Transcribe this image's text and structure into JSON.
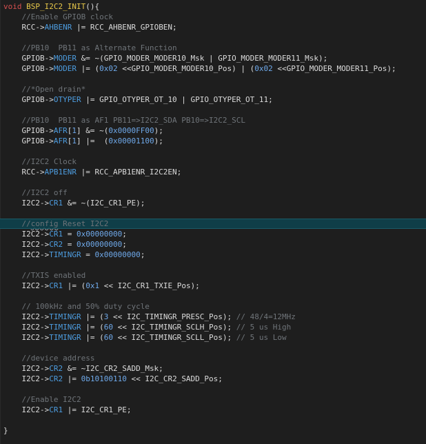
{
  "editor": {
    "current_line_index": 21,
    "lines": [
      [
        [
          "kw",
          "void"
        ],
        [
          "plain",
          " "
        ],
        [
          "fn",
          "BSP_I2C2_INIT"
        ],
        [
          "plain",
          "(){"
        ]
      ],
      [
        [
          "plain",
          "    "
        ],
        [
          "comment",
          "//Enable GPIOB clock"
        ]
      ],
      [
        [
          "plain",
          "    RCC->"
        ],
        [
          "member",
          "AHBENR"
        ],
        [
          "plain",
          " |= RCC_AHBENR_GPIOBEN;"
        ]
      ],
      [],
      [
        [
          "plain",
          "    "
        ],
        [
          "comment",
          "//PB10  PB11 as Alternate Function"
        ]
      ],
      [
        [
          "plain",
          "    GPIOB->"
        ],
        [
          "member",
          "MODER"
        ],
        [
          "plain",
          " &= ~(GPIO_MODER_MODER10_Msk | GPIO_MODER_MODER11_Msk);"
        ]
      ],
      [
        [
          "plain",
          "    GPIOB->"
        ],
        [
          "member",
          "MODER"
        ],
        [
          "plain",
          " |= ("
        ],
        [
          "num",
          "0x02"
        ],
        [
          "plain",
          " <<GPIO_MODER_MODER10_Pos) | ("
        ],
        [
          "num",
          "0x02"
        ],
        [
          "plain",
          " <<GPIO_MODER_MODER11_Pos);"
        ]
      ],
      [],
      [
        [
          "plain",
          "    "
        ],
        [
          "comment",
          "//*Open drain*"
        ]
      ],
      [
        [
          "plain",
          "    GPIOB->"
        ],
        [
          "member",
          "OTYPER"
        ],
        [
          "plain",
          " |= GPIO_OTYPER_OT_10 | GPIO_OTYPER_OT_11;"
        ]
      ],
      [],
      [
        [
          "plain",
          "    "
        ],
        [
          "comment",
          "//PB10  PB11 as AF1 PB11=>I2C2_SDA PB10=>I2C2_SCL"
        ]
      ],
      [
        [
          "plain",
          "    GPIOB->"
        ],
        [
          "member",
          "AFR"
        ],
        [
          "plain",
          "["
        ],
        [
          "num",
          "1"
        ],
        [
          "plain",
          "] &= ~("
        ],
        [
          "num",
          "0x0000FF00"
        ],
        [
          "plain",
          ");"
        ]
      ],
      [
        [
          "plain",
          "    GPIOB->"
        ],
        [
          "member",
          "AFR"
        ],
        [
          "plain",
          "["
        ],
        [
          "num",
          "1"
        ],
        [
          "plain",
          "] |=  ("
        ],
        [
          "num",
          "0x00001100"
        ],
        [
          "plain",
          ");"
        ]
      ],
      [],
      [
        [
          "plain",
          "    "
        ],
        [
          "comment",
          "//I2C2 Clock"
        ]
      ],
      [
        [
          "plain",
          "    RCC->"
        ],
        [
          "member",
          "APB1ENR"
        ],
        [
          "plain",
          " |= RCC_APB1ENR_I2C2EN;"
        ]
      ],
      [],
      [
        [
          "plain",
          "    "
        ],
        [
          "comment",
          "//I2C2 off"
        ]
      ],
      [
        [
          "plain",
          "    I2C2->"
        ],
        [
          "member",
          "CR1"
        ],
        [
          "plain",
          " &= ~(I2C_CR1_PE);"
        ]
      ],
      [],
      [
        [
          "plain",
          "    "
        ],
        [
          "comment",
          "//"
        ],
        [
          "squiggle",
          "config"
        ],
        [
          "comment",
          " Reset I2C2"
        ]
      ],
      [
        [
          "plain",
          "    I2C2->"
        ],
        [
          "member",
          "CR1"
        ],
        [
          "plain",
          " = "
        ],
        [
          "num",
          "0x00000000"
        ],
        [
          "plain",
          ";"
        ]
      ],
      [
        [
          "plain",
          "    I2C2->"
        ],
        [
          "member",
          "CR2"
        ],
        [
          "plain",
          " = "
        ],
        [
          "num",
          "0x00000000"
        ],
        [
          "plain",
          ";"
        ]
      ],
      [
        [
          "plain",
          "    I2C2->"
        ],
        [
          "member",
          "TIMINGR"
        ],
        [
          "plain",
          " = "
        ],
        [
          "num",
          "0x00000000"
        ],
        [
          "plain",
          ";"
        ]
      ],
      [],
      [
        [
          "plain",
          "    "
        ],
        [
          "comment",
          "//TXIS enabled"
        ]
      ],
      [
        [
          "plain",
          "    I2C2->"
        ],
        [
          "member",
          "CR1"
        ],
        [
          "plain",
          " |= ("
        ],
        [
          "num",
          "0x1"
        ],
        [
          "plain",
          " << I2C_CR1_TXIE_Pos);"
        ]
      ],
      [],
      [
        [
          "plain",
          "    "
        ],
        [
          "comment",
          "// 100kHz and 50% duty cycle"
        ]
      ],
      [
        [
          "plain",
          "    I2C2->"
        ],
        [
          "member",
          "TIMINGR"
        ],
        [
          "plain",
          " |= ("
        ],
        [
          "num",
          "3"
        ],
        [
          "plain",
          " << I2C_TIMINGR_PRESC_Pos); "
        ],
        [
          "comment",
          "// 48/4=12MHz"
        ]
      ],
      [
        [
          "plain",
          "    I2C2->"
        ],
        [
          "member",
          "TIMINGR"
        ],
        [
          "plain",
          " |= ("
        ],
        [
          "num",
          "60"
        ],
        [
          "plain",
          " << I2C_TIMINGR_SCLH_Pos); "
        ],
        [
          "comment",
          "// 5 us High"
        ]
      ],
      [
        [
          "plain",
          "    I2C2->"
        ],
        [
          "member",
          "TIMINGR"
        ],
        [
          "plain",
          " |= ("
        ],
        [
          "num",
          "60"
        ],
        [
          "plain",
          " << I2C_TIMINGR_SCLL_Pos); "
        ],
        [
          "comment",
          "// 5 us Low"
        ]
      ],
      [],
      [
        [
          "plain",
          "    "
        ],
        [
          "comment",
          "//device address"
        ]
      ],
      [
        [
          "plain",
          "    I2C2->"
        ],
        [
          "member",
          "CR2"
        ],
        [
          "plain",
          " &= ~I2C_CR2_SADD_Msk;"
        ]
      ],
      [
        [
          "plain",
          "    I2C2->"
        ],
        [
          "member",
          "CR2"
        ],
        [
          "plain",
          " |= "
        ],
        [
          "num",
          "0b10100110"
        ],
        [
          "plain",
          " << I2C_CR2_SADD_Pos;"
        ]
      ],
      [],
      [
        [
          "plain",
          "    "
        ],
        [
          "comment",
          "//Enable I2C2"
        ]
      ],
      [
        [
          "plain",
          "    I2C2->"
        ],
        [
          "member",
          "CR1"
        ],
        [
          "plain",
          " |= I2C_CR1_PE;"
        ]
      ],
      [],
      [
        [
          "plain",
          "}"
        ]
      ]
    ]
  }
}
